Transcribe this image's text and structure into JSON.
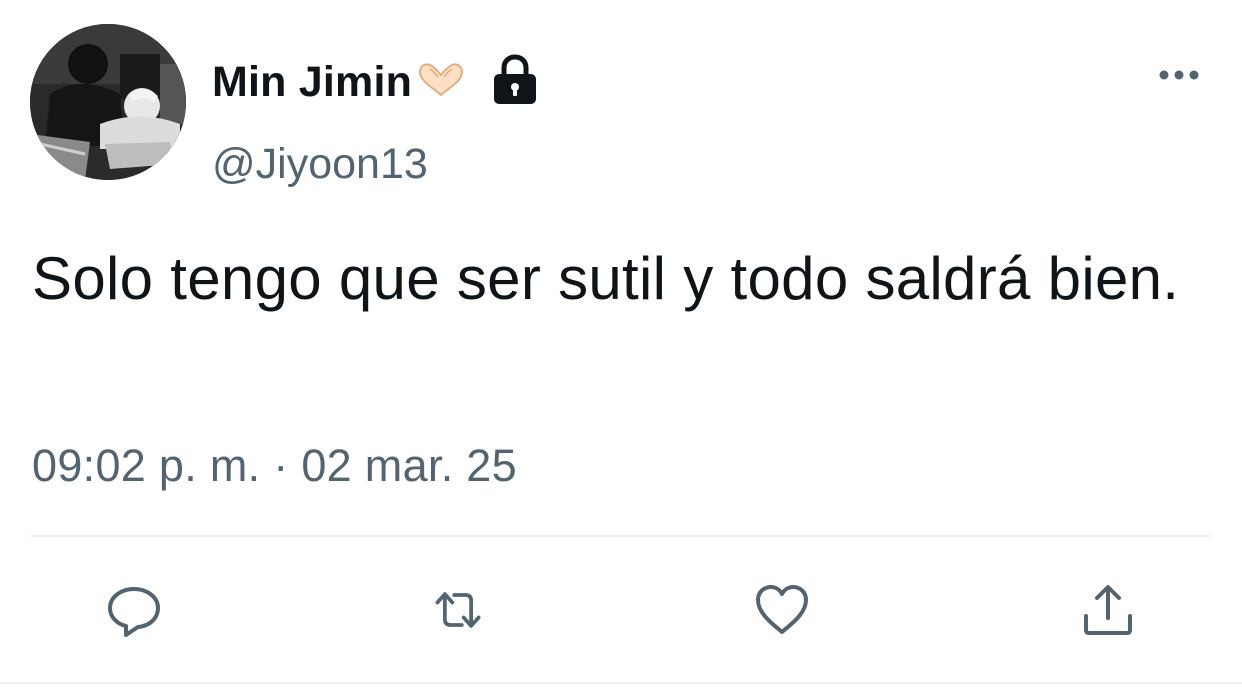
{
  "tweet": {
    "display_name": "Min Jimin",
    "name_emoji_icon": "heart-hands-icon",
    "protected_icon": "lock-icon",
    "handle": "@Jiyoon13",
    "text": "Solo tengo que ser sutil y todo saldrá bien.",
    "timestamp": "09:02 p. m. · 02 mar. 25"
  },
  "actions": [
    {
      "name": "reply",
      "icon": "reply-icon"
    },
    {
      "name": "retweet",
      "icon": "retweet-icon"
    },
    {
      "name": "like",
      "icon": "heart-icon"
    },
    {
      "name": "share",
      "icon": "share-icon"
    }
  ],
  "colors": {
    "text_primary": "#0f1419",
    "text_secondary": "#536471",
    "icon_gray": "#536471",
    "divider": "#eff3f4"
  }
}
